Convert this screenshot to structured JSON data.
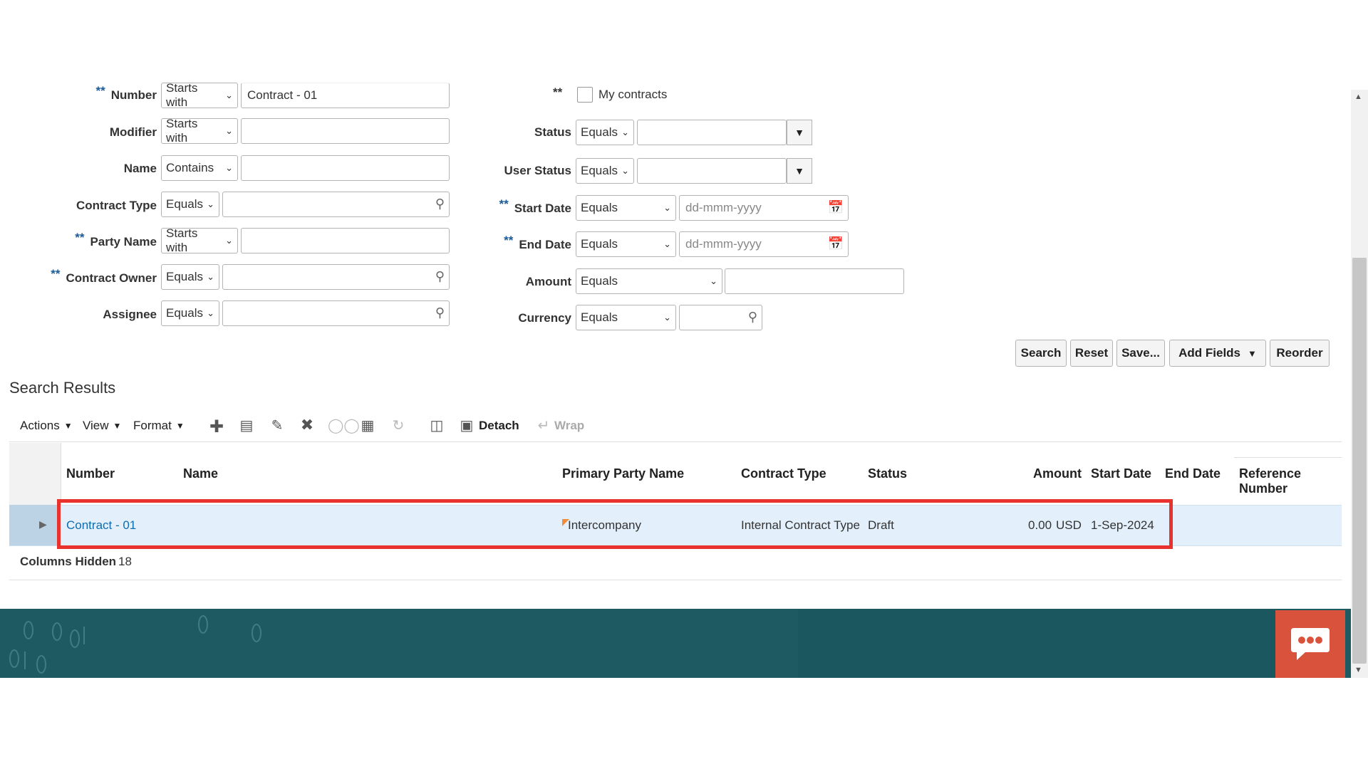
{
  "search_form": {
    "left_fields": [
      {
        "label": "Number",
        "required": true,
        "operator": "Starts with",
        "value": "Contract - 01",
        "lookup": false
      },
      {
        "label": "Modifier",
        "required": false,
        "operator": "Starts with",
        "value": "",
        "lookup": false
      },
      {
        "label": "Name",
        "required": false,
        "operator": "Contains",
        "value": "",
        "lookup": false
      },
      {
        "label": "Contract Type",
        "required": false,
        "operator": "Equals",
        "value": "",
        "lookup": true
      },
      {
        "label": "Party Name",
        "required": true,
        "operator": "Starts with",
        "value": "",
        "lookup": false
      },
      {
        "label": "Contract Owner",
        "required": true,
        "operator": "Equals",
        "value": "",
        "lookup": true
      },
      {
        "label": "Assignee",
        "required": false,
        "operator": "Equals",
        "value": "",
        "lookup": true
      }
    ],
    "required_marker": "**",
    "my_contracts_label": "My contracts",
    "status": {
      "label": "Status",
      "operator": "Equals",
      "value": ""
    },
    "user_status": {
      "label": "User Status",
      "operator": "Equals",
      "value": ""
    },
    "start_date": {
      "label": "Start Date",
      "operator": "Equals",
      "placeholder": "dd-mmm-yyyy"
    },
    "end_date": {
      "label": "End Date",
      "operator": "Equals",
      "placeholder": "dd-mmm-yyyy"
    },
    "amount": {
      "label": "Amount",
      "operator": "Equals",
      "value": ""
    },
    "currency": {
      "label": "Currency",
      "operator": "Equals",
      "value": ""
    },
    "buttons": {
      "search": "Search",
      "reset": "Reset",
      "save": "Save...",
      "add_fields": "Add Fields",
      "reorder": "Reorder"
    }
  },
  "results": {
    "title": "Search Results",
    "toolbar": {
      "actions": "Actions",
      "view": "View",
      "format": "Format",
      "detach": "Detach",
      "wrap": "Wrap"
    },
    "columns": {
      "number": "Number",
      "name": "Name",
      "primary_party": "Primary Party Name",
      "contract_type": "Contract Type",
      "status": "Status",
      "amount": "Amount",
      "start_date": "Start Date",
      "end_date": "End Date",
      "reference_number": "Reference Number"
    },
    "row": {
      "number": "Contract - 01",
      "name": "",
      "primary_party": "Intercompany",
      "contract_type": "Internal Contract Type",
      "status": "Draft",
      "amount": "0.00",
      "currency": "USD",
      "start_date": "1-Sep-2024",
      "end_date": "",
      "reference_number": ""
    },
    "columns_hidden_label": "Columns Hidden",
    "columns_hidden_count": "18"
  },
  "colors": {
    "highlight_border": "#e8322d",
    "link": "#0f6cb0",
    "footer": "#1d5a62",
    "chat_button": "#d9523c",
    "selected_row": "#e3f0fb"
  }
}
